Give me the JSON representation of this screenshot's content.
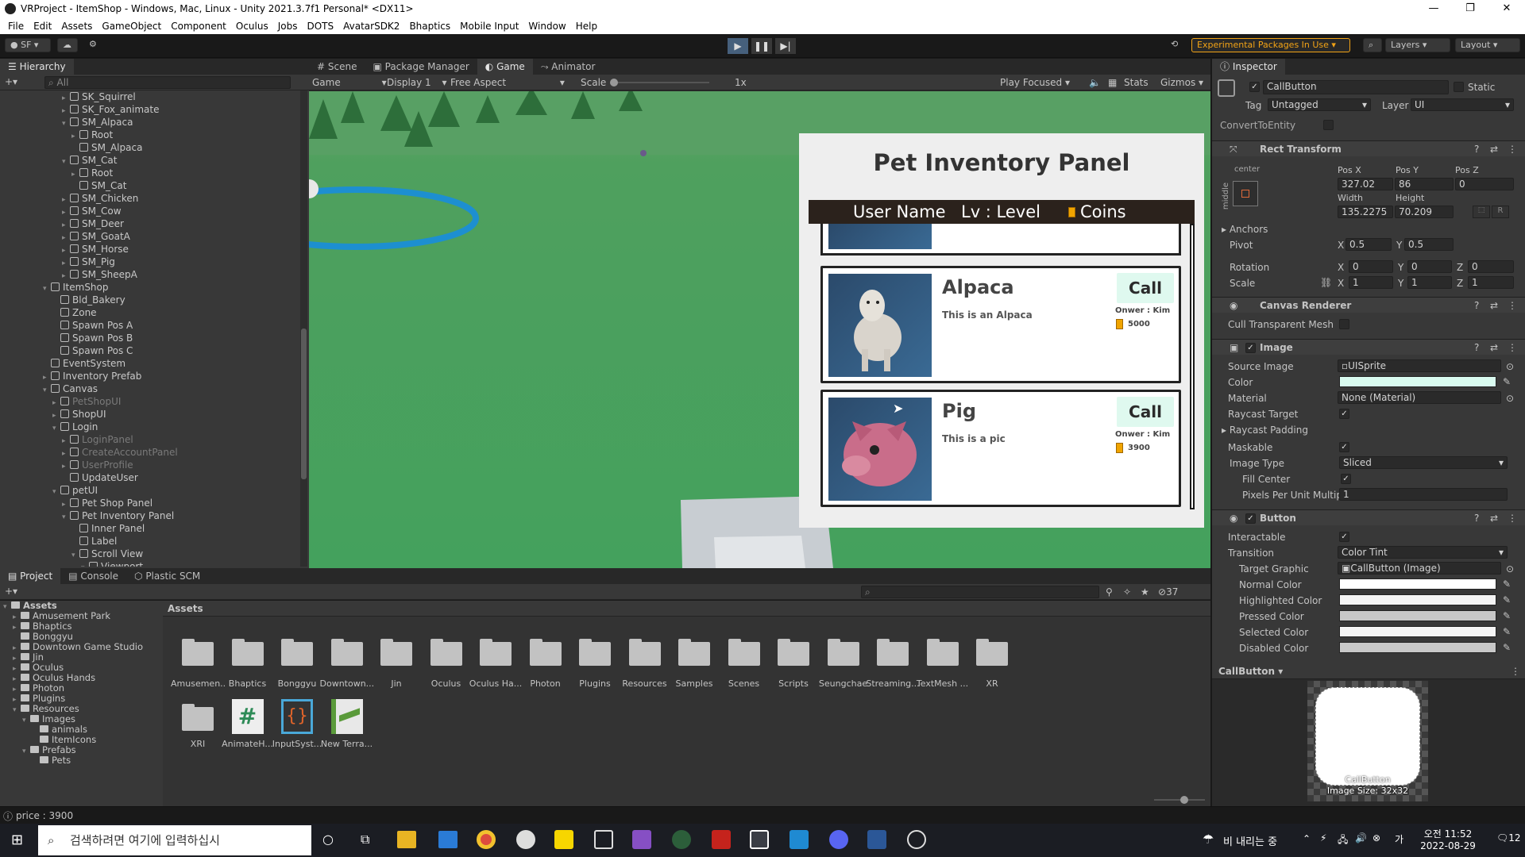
{
  "window": {
    "title": "VRProject - ItemShop - Windows, Mac, Linux - Unity 2021.3.7f1 Personal* <DX11>"
  },
  "menu": [
    "File",
    "Edit",
    "Assets",
    "GameObject",
    "Component",
    "Oculus",
    "Jobs",
    "DOTS",
    "AvatarSDK2",
    "Bhaptics",
    "Mobile Input",
    "Window",
    "Help"
  ],
  "toolbar": {
    "account": "SF",
    "experimental": "Experimental Packages In Use",
    "layers": "Layers",
    "layout": "Layout"
  },
  "hierarchy": {
    "tab": "Hierarchy",
    "search_placeholder": "All",
    "rows": [
      {
        "t": "SK_Squirrel",
        "d": 6,
        "a": "▸",
        "s": ""
      },
      {
        "t": "SK_Fox_animate",
        "d": 6,
        "a": "▸",
        "s": ""
      },
      {
        "t": "SM_Alpaca",
        "d": 6,
        "a": "▾",
        "s": ""
      },
      {
        "t": "Root",
        "d": 7,
        "a": "▸",
        "s": ""
      },
      {
        "t": "SM_Alpaca",
        "d": 7,
        "a": "",
        "s": ""
      },
      {
        "t": "SM_Cat",
        "d": 6,
        "a": "▾",
        "s": ""
      },
      {
        "t": "Root",
        "d": 7,
        "a": "▸",
        "s": ""
      },
      {
        "t": "SM_Cat",
        "d": 7,
        "a": "",
        "s": ""
      },
      {
        "t": "SM_Chicken",
        "d": 6,
        "a": "▸",
        "s": ""
      },
      {
        "t": "SM_Cow",
        "d": 6,
        "a": "▸",
        "s": ""
      },
      {
        "t": "SM_Deer",
        "d": 6,
        "a": "▸",
        "s": ""
      },
      {
        "t": "SM_GoatA",
        "d": 6,
        "a": "▸",
        "s": ""
      },
      {
        "t": "SM_Horse",
        "d": 6,
        "a": "▸",
        "s": ""
      },
      {
        "t": "SM_Pig",
        "d": 6,
        "a": "▸",
        "s": ""
      },
      {
        "t": "SM_SheepA",
        "d": 6,
        "a": "▸",
        "s": ""
      },
      {
        "t": "ItemShop",
        "d": 4,
        "a": "▾",
        "s": ""
      },
      {
        "t": "Bld_Bakery",
        "d": 5,
        "a": "",
        "s": ""
      },
      {
        "t": "Zone",
        "d": 5,
        "a": "",
        "s": ""
      },
      {
        "t": "Spawn Pos A",
        "d": 5,
        "a": "",
        "s": ""
      },
      {
        "t": "Spawn Pos B",
        "d": 5,
        "a": "",
        "s": ""
      },
      {
        "t": "Spawn Pos C",
        "d": 5,
        "a": "",
        "s": ""
      },
      {
        "t": "EventSystem",
        "d": 4,
        "a": "",
        "s": ""
      },
      {
        "t": "Inventory Prefab",
        "d": 4,
        "a": "▸",
        "s": ""
      },
      {
        "t": "Canvas",
        "d": 4,
        "a": "▾",
        "s": ""
      },
      {
        "t": "PetShopUI",
        "d": 5,
        "a": "▸",
        "s": "dim"
      },
      {
        "t": "ShopUI",
        "d": 5,
        "a": "▸",
        "s": ""
      },
      {
        "t": "Login",
        "d": 5,
        "a": "▾",
        "s": ""
      },
      {
        "t": "LoginPanel",
        "d": 6,
        "a": "▸",
        "s": "dim"
      },
      {
        "t": "CreateAccountPanel",
        "d": 6,
        "a": "▸",
        "s": "dim"
      },
      {
        "t": "UserProfile",
        "d": 6,
        "a": "▸",
        "s": "dim"
      },
      {
        "t": "UpdateUser",
        "d": 6,
        "a": "",
        "s": ""
      },
      {
        "t": "petUI",
        "d": 5,
        "a": "▾",
        "s": ""
      },
      {
        "t": "Pet Shop Panel",
        "d": 6,
        "a": "▸",
        "s": ""
      },
      {
        "t": "Pet Inventory Panel",
        "d": 6,
        "a": "▾",
        "s": ""
      },
      {
        "t": "Inner Panel",
        "d": 7,
        "a": "",
        "s": ""
      },
      {
        "t": "Label",
        "d": 7,
        "a": "",
        "s": ""
      },
      {
        "t": "Scroll View",
        "d": 7,
        "a": "▾",
        "s": ""
      },
      {
        "t": "Viewport",
        "d": 8,
        "a": "▾",
        "s": ""
      }
    ]
  },
  "scene_tabs": [
    "Scene",
    "Package Manager",
    "Game",
    "Animator"
  ],
  "game_bar": {
    "view": "Game",
    "display": "Display 1",
    "aspect": "Free Aspect",
    "scale_label": "Scale",
    "scale_value": "1x",
    "play_focused": "Play Focused",
    "stats": "Stats",
    "gizmos": "Gizmos"
  },
  "game_ui": {
    "title": "Pet Inventory Panel",
    "user_name": "User Name",
    "level": "Lv : Level",
    "coins": "Coins",
    "pets": [
      {
        "name": "Alpaca",
        "desc": "This is an Alpaca",
        "call": "Call",
        "owner": "Onwer : Kim",
        "price": "5000"
      },
      {
        "name": "Pig",
        "desc": "This is a pic",
        "call": "Call",
        "owner": "Onwer : Kim",
        "price": "3900"
      }
    ]
  },
  "inspector": {
    "tab": "Inspector",
    "object_name": "CallButton",
    "static": "Static",
    "tag_label": "Tag",
    "tag": "Untagged",
    "layer_label": "Layer",
    "layer": "UI",
    "convert": "ConvertToEntity",
    "rect": {
      "title": "Rect Transform",
      "anchor_h": "center",
      "anchor_v": "middle",
      "posx_label": "Pos X",
      "posy_label": "Pos Y",
      "posz_label": "Pos Z",
      "posx": "327.02",
      "posy": "86",
      "posz": "0",
      "w_label": "Width",
      "h_label": "Height",
      "width": "135.2275",
      "height": "70.209",
      "anchors": "Anchors",
      "pivot": "Pivot",
      "pivot_x": "0.5",
      "pivot_y": "0.5",
      "rotation": "Rotation",
      "rot_x": "0",
      "rot_y": "0",
      "rot_z": "0",
      "scale": "Scale",
      "scale_x": "1",
      "scale_y": "1",
      "scale_z": "1",
      "x": "X",
      "y": "Y",
      "z": "Z"
    },
    "canvas_renderer": {
      "title": "Canvas Renderer",
      "cull": "Cull Transparent Mesh"
    },
    "image": {
      "title": "Image",
      "source_label": "Source Image",
      "source": "UISprite",
      "color_label": "Color",
      "color": "#d9fbf0",
      "material_label": "Material",
      "material": "None (Material)",
      "raycast_target": "Raycast Target",
      "raycast_padding": "Raycast Padding",
      "maskable": "Maskable",
      "type_label": "Image Type",
      "type": "Sliced",
      "fill_center": "Fill Center",
      "ppu_label": "Pixels Per Unit Multipl",
      "ppu": "1"
    },
    "button": {
      "title": "Button",
      "interactable": "Interactable",
      "transition_label": "Transition",
      "transition": "Color Tint",
      "target_label": "Target Graphic",
      "target": "CallButton (Image)",
      "normal": "Normal Color",
      "highlighted": "Highlighted Color",
      "pressed": "Pressed Color",
      "selected": "Selected Color",
      "disabled": "Disabled Color"
    },
    "preview": {
      "title": "CallButton",
      "name": "CallButton",
      "size": "Image Size: 32x32"
    }
  },
  "project": {
    "tabs": [
      "Project",
      "Console",
      "Plastic SCM"
    ],
    "count": "37",
    "breadcrumb": "Assets",
    "tree": [
      {
        "t": "Assets",
        "d": 0,
        "a": "▾",
        "b": true
      },
      {
        "t": "Amusement Park",
        "d": 1,
        "a": "▸"
      },
      {
        "t": "Bhaptics",
        "d": 1,
        "a": "▸"
      },
      {
        "t": "Bonggyu",
        "d": 1,
        "a": ""
      },
      {
        "t": "Downtown Game Studio",
        "d": 1,
        "a": "▸"
      },
      {
        "t": "Jin",
        "d": 1,
        "a": "▸"
      },
      {
        "t": "Oculus",
        "d": 1,
        "a": "▸"
      },
      {
        "t": "Oculus Hands",
        "d": 1,
        "a": "▸"
      },
      {
        "t": "Photon",
        "d": 1,
        "a": "▸"
      },
      {
        "t": "Plugins",
        "d": 1,
        "a": "▸"
      },
      {
        "t": "Resources",
        "d": 1,
        "a": "▾"
      },
      {
        "t": "Images",
        "d": 2,
        "a": "▾"
      },
      {
        "t": "animals",
        "d": 3,
        "a": ""
      },
      {
        "t": "ItemIcons",
        "d": 3,
        "a": ""
      },
      {
        "t": "Prefabs",
        "d": 2,
        "a": "▾"
      },
      {
        "t": "Pets",
        "d": 3,
        "a": ""
      }
    ],
    "folders": [
      "Amusemen...",
      "Bhaptics",
      "Bonggyu",
      "Downtown...",
      "Jin",
      "Oculus",
      "Oculus Ha...",
      "Photon",
      "Plugins",
      "Resources",
      "Samples",
      "Scenes",
      "Scripts",
      "Seungchae",
      "Streaming...",
      "TextMesh ...",
      "XR"
    ],
    "row2": [
      {
        "label": "XRI",
        "icon": "folder-icon"
      },
      {
        "label": "AnimateH...",
        "icon": "csharp-script-icon"
      },
      {
        "label": "InputSyst...",
        "icon": "input-actions-icon"
      },
      {
        "label": "New Terra...",
        "icon": "terrain-icon"
      }
    ]
  },
  "status": {
    "text": "price : 3900"
  },
  "taskbar": {
    "search": "검색하려면 여기에 입력하십시",
    "weather": "비 내리는 중",
    "time": "오전 11:52",
    "date": "2022-08-29",
    "notif": "12"
  }
}
